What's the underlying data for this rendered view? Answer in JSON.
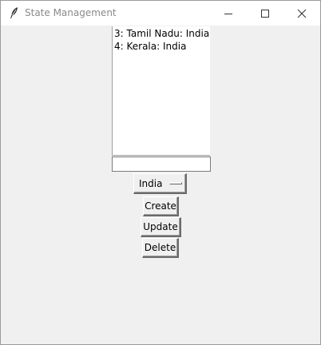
{
  "window": {
    "title": "State Management"
  },
  "icons": {
    "app": "feather-icon",
    "minimize": "minimize-icon",
    "maximize": "maximize-icon",
    "close": "close-icon"
  },
  "listbox": {
    "items": [
      "3: Tamil Nadu: India",
      "4: Kerala: India"
    ]
  },
  "entry": {
    "value": ""
  },
  "country_select": {
    "selected": "India"
  },
  "buttons": {
    "create": "Create",
    "update": "Update",
    "delete": "Delete"
  }
}
